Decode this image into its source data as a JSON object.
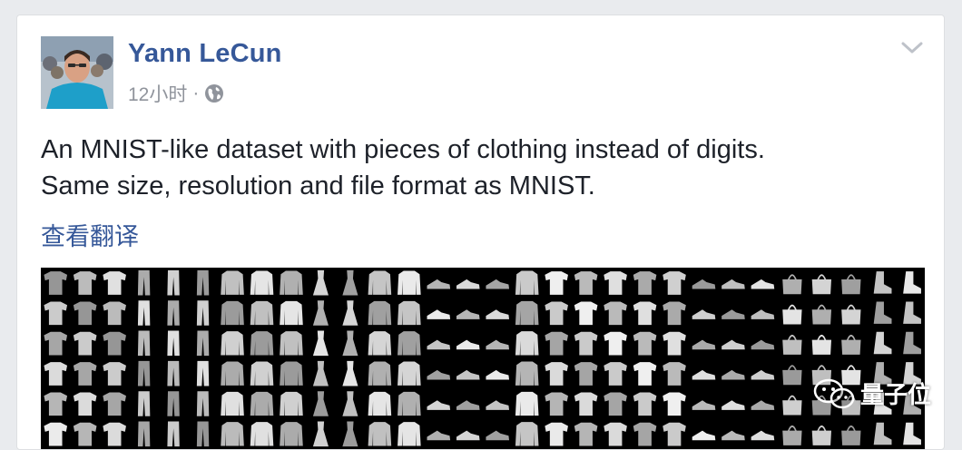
{
  "post": {
    "author": "Yann LeCun",
    "timestamp": "12小时",
    "separator": "·",
    "privacy_icon": "globe-icon",
    "menu_icon": "chevron-down-icon",
    "text_line1": "An MNIST-like dataset with pieces of clothing instead of digits.",
    "text_line2": "Same size, resolution and file format as MNIST.",
    "translate_link": "查看翻译"
  },
  "image": {
    "description_icon": "fashion-mnist-grid",
    "watermark_text": "量子位",
    "watermark_icon": "wechat-icon"
  },
  "colors": {
    "link": "#365899",
    "text": "#1d2129",
    "meta": "#90949c",
    "background": "#e9ebee"
  }
}
